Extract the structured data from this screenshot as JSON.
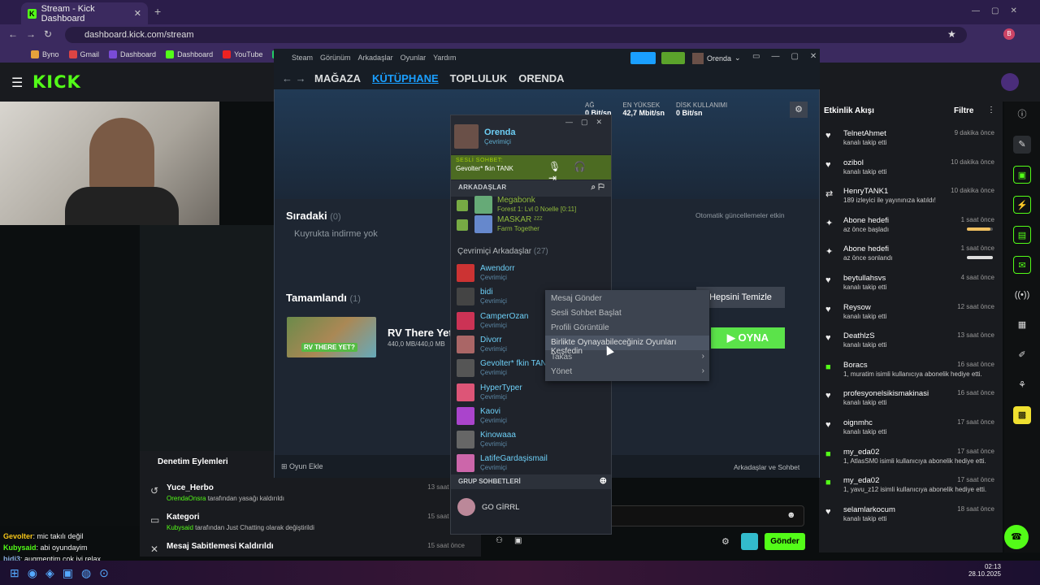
{
  "browser": {
    "tab_title": "Stream - Kick Dashboard",
    "url": "dashboard.kick.com/stream",
    "bookmarks": [
      {
        "label": "Byno",
        "color": "#e7a23b"
      },
      {
        "label": "Gmail",
        "color": "#d44"
      },
      {
        "label": "Dashboard",
        "color": "#7a4bd6"
      },
      {
        "label": "Dashboard",
        "color": "#53fc18"
      },
      {
        "label": "YouTube",
        "color": "#e22"
      },
      {
        "label": "W",
        "color": "#2c6"
      }
    ]
  },
  "kick": {
    "logo": "KICK",
    "mod_panel": {
      "title": "Denetim Eylemleri",
      "rows": [
        {
          "title": "Yuce_Herbo",
          "user": "OrendaOnsra",
          "desc": " tarafından yasağı kaldırıldı",
          "time": "13 saat önce"
        },
        {
          "title": "Kategori",
          "user": "Kubysaid",
          "desc": " tarafından Just Chatting olarak değiştirildi",
          "time": "15 saat önce"
        },
        {
          "title": "Mesaj Sabitlemesi Kaldırıldı",
          "user": "",
          "desc": "",
          "time": "15 saat önce"
        }
      ]
    },
    "chat": [
      {
        "user": "Gevolter",
        "msg": ": mic takılı değil",
        "cls": "y"
      },
      {
        "user": "Kubysaid",
        "msg": ": abi oyundayim",
        "cls": "g"
      },
      {
        "user": "bidi3",
        "msg": ": augmentim çok iyi relax",
        "cls": "c"
      }
    ],
    "activity": {
      "title": "Etkinlik Akışı",
      "filter": "Filtre",
      "items": [
        {
          "icon": "♥",
          "name": "TelnetAhmet",
          "sub": "kanalı takip etti",
          "time": "9 dakika önce"
        },
        {
          "icon": "♥",
          "name": "ozibol",
          "sub": "kanalı takip etti",
          "time": "10 dakika önce"
        },
        {
          "icon": "⇄",
          "name": "HenryTANK1",
          "sub": "189 izleyici ile yayınınıza katıldı!",
          "time": "10 dakika önce"
        },
        {
          "icon": "✦",
          "name": "Abone hedefi",
          "sub": "az önce başladı",
          "time": "1 saat önce",
          "progress": 0.9
        },
        {
          "icon": "✦",
          "name": "Abone hedefi",
          "sub": "az önce sonlandı",
          "time": "1 saat önce",
          "progress": 1.0
        },
        {
          "icon": "♥",
          "name": "beytullahsvs",
          "sub": "kanalı takip etti",
          "time": "4 saat önce"
        },
        {
          "icon": "♥",
          "name": "Reysow",
          "sub": "kanalı takip etti",
          "time": "12 saat önce"
        },
        {
          "icon": "♥",
          "name": "DeathlzS",
          "sub": "kanalı takip etti",
          "time": "13 saat önce"
        },
        {
          "icon": "■",
          "name": "Boracs",
          "sub": "1, muratim isimli kullanıcıya abonelik hediye etti.",
          "time": "16 saat önce"
        },
        {
          "icon": "♥",
          "name": "profesyonelsikismakinasi",
          "sub": "kanalı takip etti",
          "time": "16 saat önce"
        },
        {
          "icon": "♥",
          "name": "oignmhc",
          "sub": "kanalı takip etti",
          "time": "17 saat önce"
        },
        {
          "icon": "■",
          "name": "my_eda02",
          "sub": "1, AtlasSM0 isimli kullanıcıya abonelik hediye etti.",
          "time": "17 saat önce"
        },
        {
          "icon": "■",
          "name": "my_eda02",
          "sub": "1, yavu_z12 isimli kullanıcıya abonelik hediye etti.",
          "time": "17 saat önce"
        },
        {
          "icon": "♥",
          "name": "selamlarkocum",
          "sub": "kanalı takip etti",
          "time": "18 saat önce"
        }
      ]
    },
    "send_label": "Gönder"
  },
  "steam": {
    "menu": [
      "Steam",
      "Görünüm",
      "Arkadaşlar",
      "Oyunlar",
      "Yardım"
    ],
    "user": "Orenda",
    "nav": [
      "MAĞAZA",
      "KÜTÜPHANE",
      "TOPLULUK",
      "ORENDA"
    ],
    "stats": [
      {
        "label": "AĞ",
        "value": "0 Bit/sn"
      },
      {
        "label": "EN YÜKSEK",
        "value": "42,7 Mbit/sn"
      },
      {
        "label": "DİSK KULLANIMI",
        "value": "0 Bit/sn"
      }
    ],
    "queue_title": "Sıradaki",
    "queue_count": "(0)",
    "queue_empty": "Kuyrukta indirme yok",
    "auto_update": "Otomatik güncellemeler etkin",
    "done_title": "Tamamlandı",
    "done_count": "(1)",
    "clear_label": "Hepsini Temizle",
    "game_title": "RV There Yet?",
    "game_size": "440,0 MB/440,0 MB",
    "game_art_text": "RV THERE YET?",
    "play_label": "OYNA",
    "add_game": "Oyun Ekle",
    "friends_chat": "Arkadaşlar ve Sohbet"
  },
  "friends": {
    "name": "Orenda",
    "status": "Çevrimiçi",
    "voice_label": "SESLİ SOHBET:",
    "voice_channel": "Gevolter* fkin TANK",
    "section": "ARKADAŞLAR",
    "ingame": [
      {
        "name": "Megabonk",
        "status": "Forest 1: Lvl 0 Noelle [0:11]",
        "color": "#6a7"
      },
      {
        "name": "MASKAR ᶻᶻᶻ",
        "status": "Farm Together",
        "color": "#68c"
      }
    ],
    "online_header": "Çevrimiçi Arkadaşlar",
    "online_count": "(27)",
    "online": [
      {
        "name": "Awendorr",
        "status": "Çevrimiçi",
        "color": "#c33"
      },
      {
        "name": "bidi",
        "status": "Çevrimiçi",
        "color": "#444"
      },
      {
        "name": "CamperOzan",
        "status": "Çevrimiçi",
        "color": "#c35"
      },
      {
        "name": "Divorr",
        "status": "Çevrimiçi",
        "color": "#a66"
      },
      {
        "name": "Gevolter* fkin TANK",
        "status": "Çevrimiçi",
        "color": "#555"
      },
      {
        "name": "HyperTyper",
        "status": "Çevrimiçi",
        "color": "#d57"
      },
      {
        "name": "Kaovi",
        "status": "Çevrimiçi",
        "color": "#a4c"
      },
      {
        "name": "Kinowaaa",
        "status": "Çevrimiçi",
        "color": "#666"
      },
      {
        "name": "LatifeGardaşismail",
        "status": "Çevrimiçi",
        "color": "#c6a"
      }
    ],
    "group_header": "GRUP SOHBETLERİ",
    "group": "GO GİRRL"
  },
  "context_menu": [
    {
      "label": "Mesaj Gönder",
      "sub": false
    },
    {
      "label": "Sesli Sohbet Başlat",
      "sub": false
    },
    {
      "label": "Profili Görüntüle",
      "sub": false
    },
    {
      "label": "Birlikte Oynayabileceğiniz Oyunları Keşfedin",
      "sub": false,
      "highlight": true
    },
    {
      "label": "Takas",
      "sub": true
    },
    {
      "label": "Yönet",
      "sub": true
    }
  ],
  "taskbar": {
    "time": "02:13",
    "date": "28.10.2025"
  }
}
